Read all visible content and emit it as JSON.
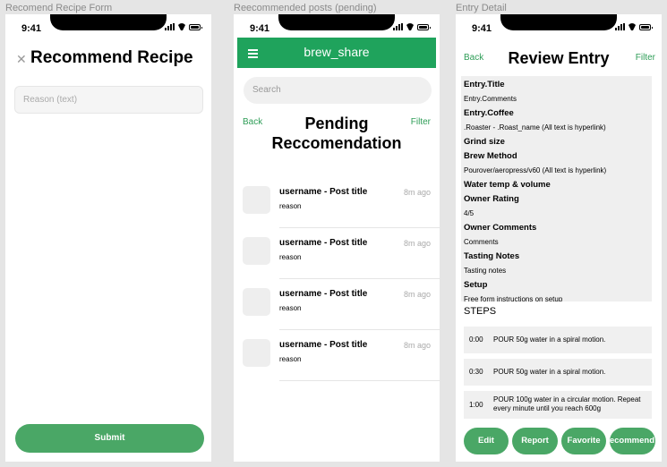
{
  "frames": {
    "recommend_label": "Recomend Recipe Form",
    "pending_label": "Reecommended posts (pending)",
    "entry_label": "Entry Detail"
  },
  "status": {
    "time": "9:41"
  },
  "recommend_form": {
    "close_icon": "close-icon",
    "title": "Recommend Recipe",
    "reason_placeholder": "Reason (text)",
    "submit_label": "Submit",
    "accent": "#4aa766"
  },
  "pending": {
    "app_title": "brew_share",
    "appbar_color": "#1fa35c",
    "search_placeholder": "Search",
    "back_label": "Back",
    "filter_label": "Filter",
    "title_line1": "Pending",
    "title_line2": "Reccomendation",
    "posts": [
      {
        "title": "username - Post title",
        "when": "8m ago",
        "reason": "reason"
      },
      {
        "title": "username - Post title",
        "when": "8m ago",
        "reason": "reason"
      },
      {
        "title": "username - Post title",
        "when": "8m ago",
        "reason": "reason"
      },
      {
        "title": "username - Post title",
        "when": "8m ago",
        "reason": "reason"
      }
    ]
  },
  "entry": {
    "back_label": "Back",
    "filter_label": "Filter",
    "title": "Review Entry",
    "fields": {
      "entry_title": "Entry.Title",
      "entry_comments": "Entry.Comments",
      "coffee_label": "Entry.Coffee",
      "coffee_value": ".Roaster - .Roast_name (All text is hyperlink)",
      "grind_label": "Grind size",
      "brew_label": "Brew Method",
      "brew_value": "Pourover/aeropress/v60 (All text is hyperlink)",
      "water_label": "Water temp & volume",
      "rating_label": "Owner Rating",
      "rating_value": "4/5",
      "owner_comments_label": "Owner Comments",
      "owner_comments_value": "Comments",
      "tasting_label": "Tasting Notes",
      "tasting_value": "Tasting notes",
      "setup_label": "Setup",
      "setup_value": "Free form instructions on setup"
    },
    "steps_heading": "STEPS",
    "steps": [
      {
        "time": "0:00",
        "desc": "POUR 50g water in a spiral motion."
      },
      {
        "time": "0:30",
        "desc": "POUR 50g water in a spiral motion."
      },
      {
        "time": "1:00",
        "desc": "POUR 100g water in a circular motion. Repeat every minute until you reach 600g"
      }
    ],
    "buttons": {
      "edit": "Edit",
      "report": "Report",
      "favorite": "Favorite",
      "recommend": "Recommend"
    }
  }
}
